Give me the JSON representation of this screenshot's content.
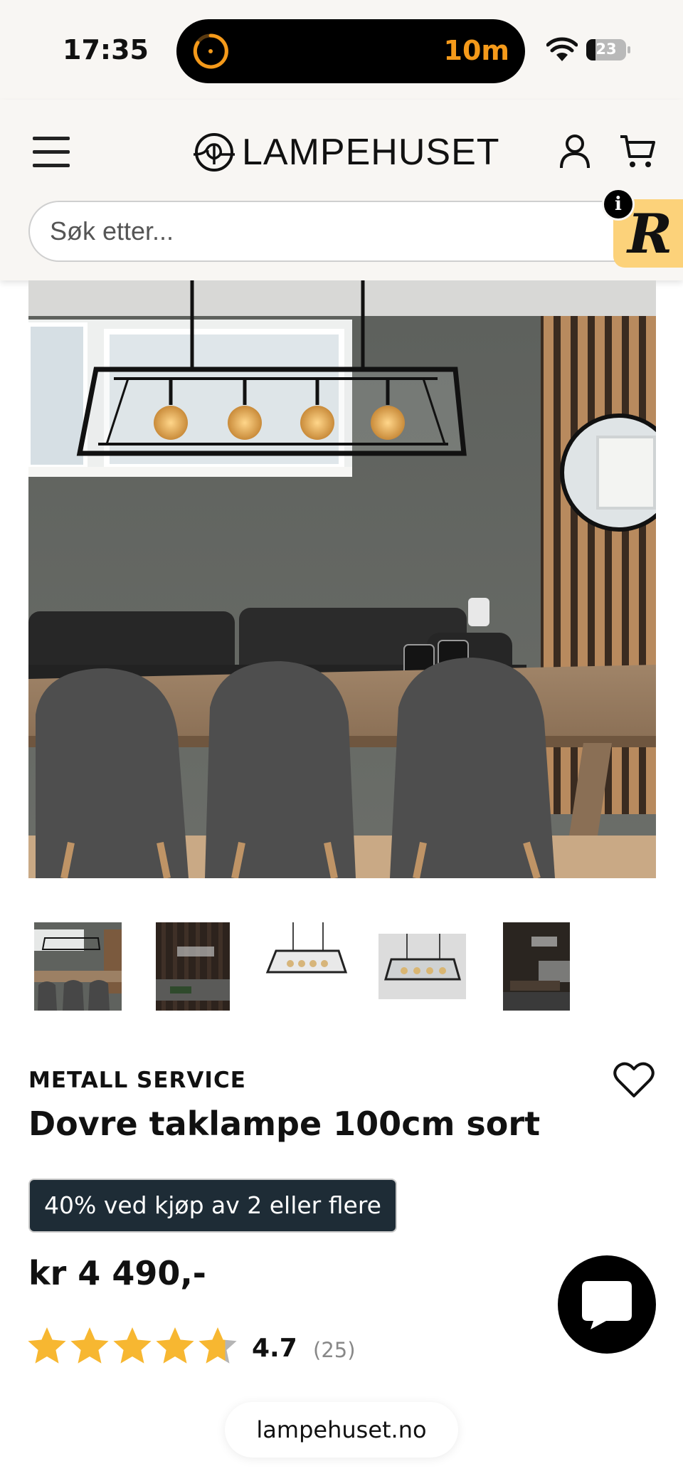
{
  "status_bar": {
    "time": "17:35",
    "timer": "10m",
    "battery": "23",
    "battery_level": 0.23,
    "accent_color": "#f59a1a"
  },
  "header": {
    "logo_text": "LAMPEHUSET",
    "icons": [
      "menu-icon",
      "lampehuset-logo-icon",
      "account-icon",
      "cart-icon"
    ],
    "background": "#f8f6f3"
  },
  "search": {
    "placeholder": "Søk etter...",
    "icon": "search-icon"
  },
  "widget": {
    "badge_letter": "R",
    "info_label": "i",
    "color": "#fcd27a"
  },
  "gallery": {
    "hero_alt_icon": "product-photo",
    "thumbnail_count": 5
  },
  "product": {
    "brand": "METALL SERVICE",
    "title": "Dovre taklampe 100cm sort",
    "promo": "40% ved kjøp av 2 eller flere",
    "promo_color": "#1e2c36",
    "price": "kr 4 490,-",
    "rating_value": 4.7,
    "rating_label": "4.7",
    "review_count": "(25)",
    "star_color": "#f7b731"
  },
  "browser": {
    "url": "lampehuset.no"
  }
}
